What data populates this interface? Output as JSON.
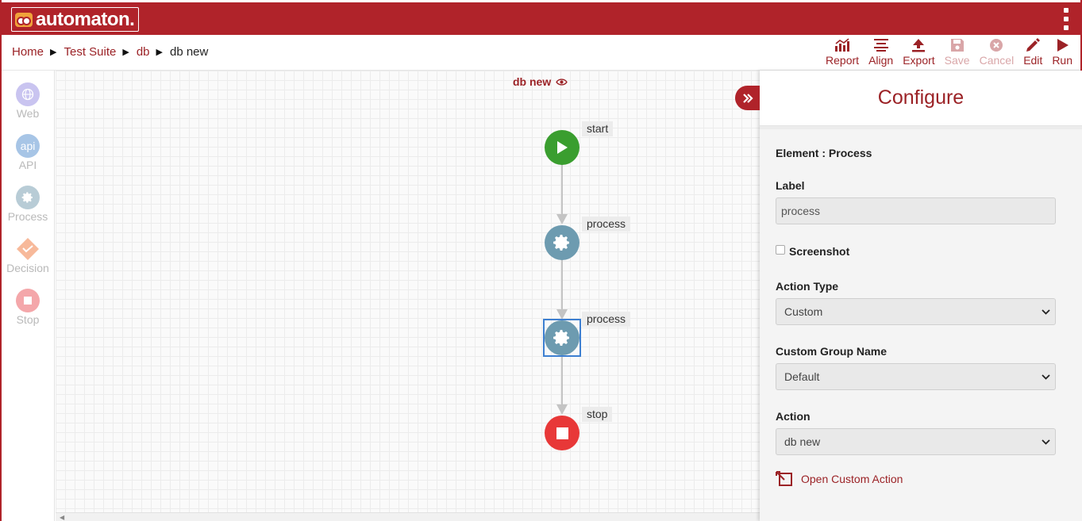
{
  "app": {
    "logo_text": "automaton."
  },
  "breadcrumb": {
    "items": [
      "Home",
      "Test Suite",
      "db"
    ],
    "current": "db new",
    "separator": "▶"
  },
  "toolbar": {
    "report": "Report",
    "align": "Align",
    "export": "Export",
    "save": "Save",
    "cancel": "Cancel",
    "edit": "Edit",
    "run": "Run"
  },
  "palette": {
    "items": [
      {
        "label": "Web",
        "icon": "globe-icon",
        "color": "#c9c4f0"
      },
      {
        "label": "API",
        "icon_text": "api",
        "color": "#a7c5e6"
      },
      {
        "label": "Process",
        "icon": "gear-icon",
        "color": "#b8ccd6"
      },
      {
        "label": "Decision",
        "icon": "diamond-icon",
        "color": "#f7b99a"
      },
      {
        "label": "Stop",
        "icon": "stop-icon",
        "color": "#f4a7aa"
      }
    ]
  },
  "canvas": {
    "title": "db new",
    "nodes": [
      {
        "label": "start",
        "type": "start",
        "color": "#3a9e2f"
      },
      {
        "label": "process",
        "type": "process",
        "color": "#6d9bb0"
      },
      {
        "label": "process",
        "type": "process",
        "color": "#6d9bb0",
        "selected": true
      },
      {
        "label": "stop",
        "type": "stop",
        "color": "#e83838"
      }
    ]
  },
  "panel": {
    "title": "Configure",
    "element_line": "Element : Process",
    "label_label": "Label",
    "label_value": "process",
    "screenshot_label": "Screenshot",
    "screenshot_checked": false,
    "action_type_label": "Action Type",
    "action_type_value": "Custom",
    "custom_group_label": "Custom Group Name",
    "custom_group_value": "Default",
    "action_label": "Action",
    "action_value": "db new",
    "open_custom_action": "Open Custom Action"
  },
  "colors": {
    "brand": "#b0232a",
    "accent_text": "#9b2226",
    "selection": "#3d7fd1"
  }
}
